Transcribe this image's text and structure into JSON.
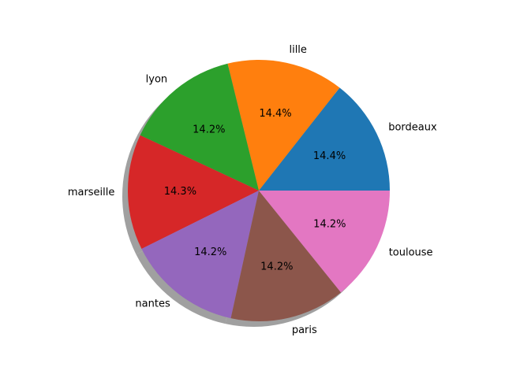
{
  "chart_data": {
    "type": "pie",
    "labels": [
      "bordeaux",
      "lille",
      "lyon",
      "marseille",
      "nantes",
      "paris",
      "toulouse"
    ],
    "values": [
      14.4,
      14.4,
      14.2,
      14.3,
      14.2,
      14.2,
      14.2
    ],
    "value_labels": [
      "14.4%",
      "14.4%",
      "14.2%",
      "14.3%",
      "14.2%",
      "14.2%",
      "14.2%"
    ],
    "colors": [
      "#1f77b4",
      "#ff7f0e",
      "#2ca02c",
      "#d62728",
      "#9467bd",
      "#8c564b",
      "#e377c2"
    ],
    "start_angle_deg": 0,
    "direction": "counterclockwise",
    "shadow": true,
    "legend": "none"
  }
}
